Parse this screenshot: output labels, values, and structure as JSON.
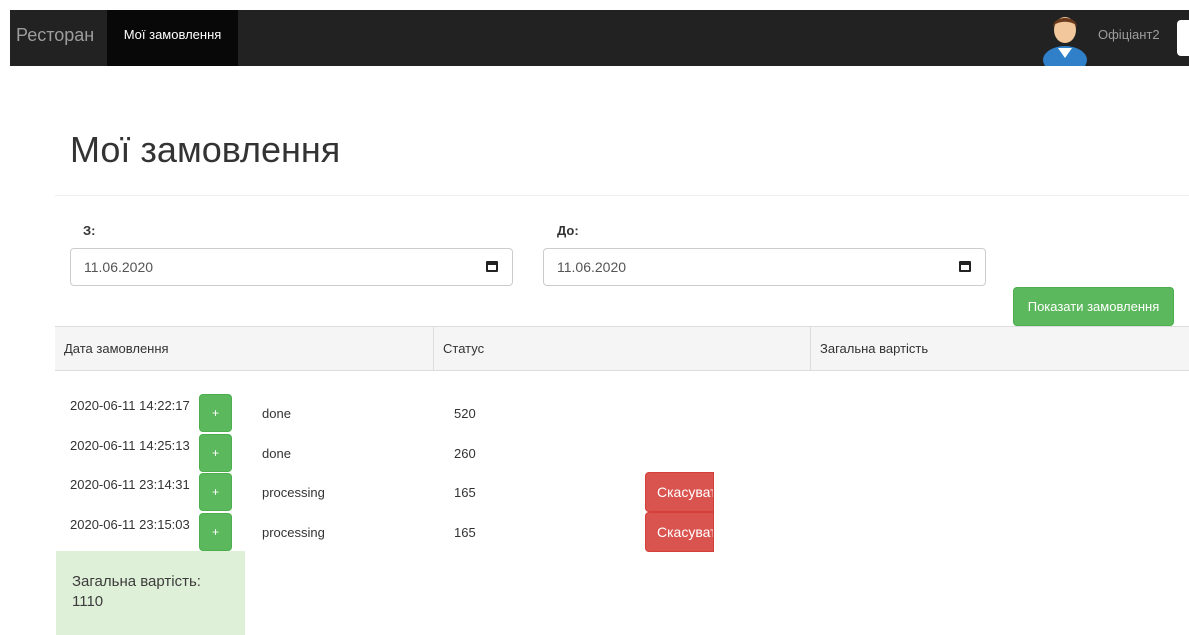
{
  "navbar": {
    "brand": "Ресторан",
    "active_item": "Мої замовлення",
    "user_name": "Офіціант2"
  },
  "page": {
    "title": "Мої замовлення"
  },
  "filter": {
    "from_label": "З:",
    "from_value": "11.06.2020",
    "to_label": "До:",
    "to_value": "11.06.2020",
    "submit_label": "Показати замовлення"
  },
  "table": {
    "headers": [
      "Дата замовлення",
      "Статус",
      "Загальна вартість"
    ],
    "rows": [
      {
        "date": "2020-06-11 14:22:17",
        "expand": "+",
        "status": "done",
        "total": "520"
      },
      {
        "date": "2020-06-11 14:25:13",
        "expand": "+",
        "status": "done",
        "total": "260"
      },
      {
        "date": "2020-06-11 23:14:31",
        "expand": "+",
        "status": "processing",
        "total": "165",
        "cancel": "Скасувати"
      },
      {
        "date": "2020-06-11 23:15:03",
        "expand": "+",
        "status": "processing",
        "total": "165",
        "cancel": "Скасувати"
      }
    ]
  },
  "summary": {
    "label": "Загальна вартість:",
    "value": "1110"
  },
  "colors": {
    "navbar": "#222222",
    "success": "#5cb85c",
    "danger": "#d9534f",
    "summary_bg": "#dff0d8"
  }
}
